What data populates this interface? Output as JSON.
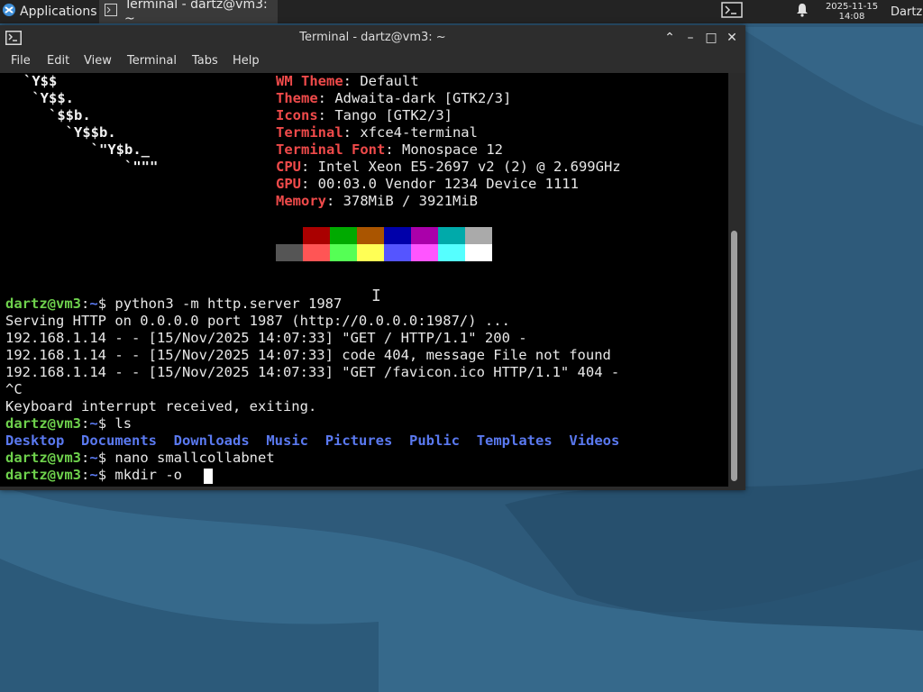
{
  "top_panel": {
    "apps_label": "Applications",
    "task_label": "Terminal - dartz@vm3: ~",
    "clock_date": "2025-11-15",
    "clock_time": "14:08",
    "user_label": "Dartz"
  },
  "window": {
    "title": "Terminal - dartz@vm3: ~",
    "menu": [
      "File",
      "Edit",
      "View",
      "Terminal",
      "Tabs",
      "Help"
    ]
  },
  "terminal": {
    "ascii_art": [
      "`Y$$",
      " `Y$$.",
      "   `$$b.",
      "     `Y$$b.",
      "        `\"Y$b._",
      "            `\"\"\""
    ],
    "sysinfo": [
      {
        "key": "WM Theme",
        "value": "Default"
      },
      {
        "key": "Theme",
        "value": "Adwaita-dark [GTK2/3]"
      },
      {
        "key": "Icons",
        "value": "Tango [GTK2/3]"
      },
      {
        "key": "Terminal",
        "value": "xfce4-terminal"
      },
      {
        "key": "Terminal Font",
        "value": "Monospace 12"
      },
      {
        "key": "CPU",
        "value": "Intel Xeon E5-2697 v2 (2) @ 2.699GHz"
      },
      {
        "key": "GPU",
        "value": "00:03.0 Vendor 1234 Device 1111"
      },
      {
        "key": "Memory",
        "value": "378MiB / 3921MiB"
      }
    ],
    "palette_top": [
      "#000000",
      "#aa0000",
      "#00aa00",
      "#aa5500",
      "#0000aa",
      "#aa00aa",
      "#00aaaa",
      "#aaaaaa"
    ],
    "palette_bottom": [
      "#555555",
      "#ff5555",
      "#55ff55",
      "#ffff55",
      "#5555ff",
      "#ff55ff",
      "#55ffff",
      "#ffffff"
    ],
    "prompt_user": "dartz@vm3",
    "prompt_path": "~",
    "cmd1": "python3 -m http.server 1987",
    "output": [
      "Serving HTTP on 0.0.0.0 port 1987 (http://0.0.0.0:1987/) ...",
      "192.168.1.14 - - [15/Nov/2025 14:07:33] \"GET / HTTP/1.1\" 200 -",
      "192.168.1.14 - - [15/Nov/2025 14:07:33] code 404, message File not found",
      "192.168.1.14 - - [15/Nov/2025 14:07:33] \"GET /favicon.ico HTTP/1.1\" 404 -",
      "^C",
      "Keyboard interrupt received, exiting."
    ],
    "cmd2": "ls",
    "dirs": [
      "Desktop",
      "Documents",
      "Downloads",
      "Music",
      "Pictures",
      "Public",
      "Templates",
      "Videos"
    ],
    "cmd3": "nano smallcollabnet",
    "cmd4": "mkdir -o "
  }
}
